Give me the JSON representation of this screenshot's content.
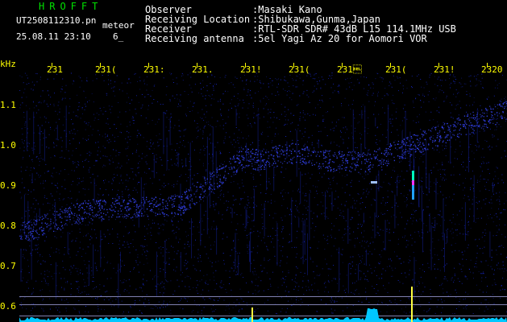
{
  "header": {
    "app_title": "HROFFT",
    "file_name": "UT2508112310.pn",
    "file_type": "meteor",
    "date_time": "25.08.11 23:10",
    "counter": "6_",
    "info": [
      {
        "label": "Observer",
        "value": ":Masaki Kano"
      },
      {
        "label": "Receiving Location",
        "value": ":Shibukawa,Gunma,Japan"
      },
      {
        "label": "Receiver",
        "value": ":RTL-SDR SDR# 43dB L15 114.1MHz USB"
      },
      {
        "label": "Receiving antenna",
        "value": ":5el Yagi Az 20 for Aomori VOR"
      }
    ]
  },
  "axes": {
    "y_unit": "kHz",
    "y_ticks": [
      "1.1",
      "1.0",
      "0.9",
      "0.8",
      "0.7",
      "0.6"
    ],
    "x_ticks": [
      "231",
      "231(",
      "231:",
      "231.",
      "231!",
      "231(",
      "231\u0007",
      "231(",
      "231!",
      "2320"
    ]
  },
  "colors": {
    "text_title": "#00e000",
    "text_header": "#ffffff",
    "axis_text": "#ffff00",
    "noise": "#1a2bd8",
    "trace": "#3848ff",
    "spectrum": "#00c8ff",
    "meteor": "#00ffc0"
  }
}
